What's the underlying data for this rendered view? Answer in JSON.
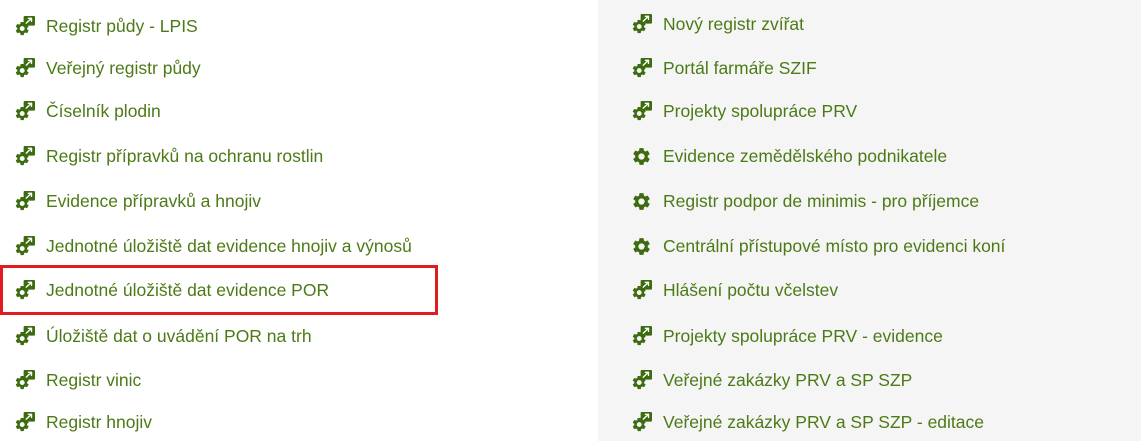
{
  "left_column": {
    "items": [
      {
        "label": "Registr půdy - LPIS",
        "icon": "gear-external-link-icon"
      },
      {
        "label": "Veřejný registr půdy",
        "icon": "gear-external-link-icon"
      },
      {
        "label": "Číselník plodin",
        "icon": "gear-external-link-icon"
      },
      {
        "label": "Registr přípravků na ochranu rostlin",
        "icon": "gear-external-link-icon"
      },
      {
        "label": "Evidence přípravků a hnojiv",
        "icon": "gear-external-link-icon"
      },
      {
        "label": "Jednotné úložiště dat evidence hnojiv a výnosů",
        "icon": "gear-external-link-icon"
      },
      {
        "label": "Jednotné úložiště dat evidence POR",
        "icon": "gear-external-link-icon",
        "highlighted": true
      },
      {
        "label": "Úložiště dat o uvádění POR na trh",
        "icon": "gear-external-link-icon"
      },
      {
        "label": "Registr vinic",
        "icon": "gear-external-link-icon"
      },
      {
        "label": "Registr hnojiv",
        "icon": "gear-external-link-icon"
      }
    ]
  },
  "right_column": {
    "items": [
      {
        "label": "Nový registr zvířat",
        "icon": "gear-external-link-icon"
      },
      {
        "label": "Portál farmáře SZIF",
        "icon": "gear-external-link-icon"
      },
      {
        "label": "Projekty spolupráce PRV",
        "icon": "gear-external-link-icon"
      },
      {
        "label": "Evidence zemědělského podnikatele",
        "icon": "gear-icon"
      },
      {
        "label": "Registr podpor de minimis - pro příjemce",
        "icon": "gear-icon"
      },
      {
        "label": "Centrální přístupové místo pro evidenci koní",
        "icon": "gear-icon"
      },
      {
        "label": "Hlášení počtu včelstev",
        "icon": "gear-external-link-icon"
      },
      {
        "label": "Projekty spolupráce PRV - evidence",
        "icon": "gear-external-link-icon"
      },
      {
        "label": "Veřejné zakázky PRV a SP SZP",
        "icon": "gear-external-link-icon"
      },
      {
        "label": "Veřejné zakázky PRV a SP SZP - editace",
        "icon": "gear-external-link-icon"
      }
    ]
  },
  "colors": {
    "link_text": "#4c7a16",
    "icon": "#3d6b10",
    "highlight_border": "#e11b22",
    "right_panel_bg": "#f5f5f5"
  }
}
